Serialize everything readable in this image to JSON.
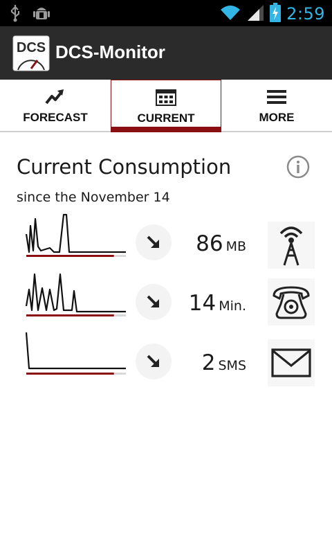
{
  "status_bar": {
    "time": "2:59",
    "icons": [
      "usb-icon",
      "android-debug-icon",
      "wifi-icon",
      "signal-icon",
      "battery-charging-icon"
    ],
    "accent_color": "#33b5e5"
  },
  "app": {
    "title": "DCS-Monitor",
    "icon_text": "DCS",
    "actionbar_color": "#2b2b2b"
  },
  "tabs": [
    {
      "label": "FORECAST",
      "icon": "trend-up-icon",
      "selected": false
    },
    {
      "label": "CURRENT",
      "icon": "calendar-grid-icon",
      "selected": true
    },
    {
      "label": "MORE",
      "icon": "menu-icon",
      "selected": false
    }
  ],
  "accent_color": "#8a0f12",
  "main": {
    "title": "Current Consumption",
    "subtitle": "since the November 14",
    "rows": [
      {
        "name": "data",
        "value": "86",
        "unit": "MB",
        "trend_icon": "arrow-down-right-icon",
        "type_icon": "antenna-icon",
        "progress": 0.88
      },
      {
        "name": "calls",
        "value": "14",
        "unit": "Min.",
        "trend_icon": "arrow-down-right-icon",
        "type_icon": "telephone-icon",
        "progress": 0.88
      },
      {
        "name": "sms",
        "value": "2",
        "unit": "SMS",
        "trend_icon": "arrow-down-right-icon",
        "type_icon": "envelope-icon",
        "progress": 0.88
      }
    ]
  }
}
